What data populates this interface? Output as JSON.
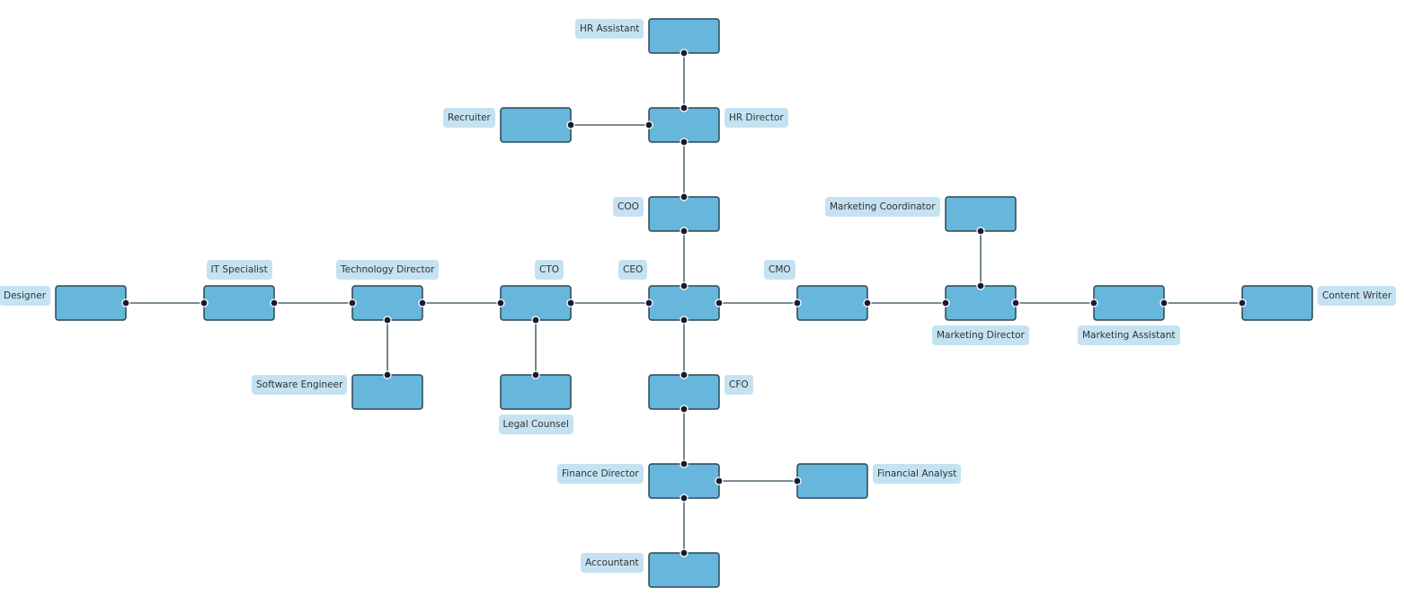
{
  "colors": {
    "node_fill": "#67b6db",
    "node_stroke": "#2b4756",
    "edge": "#2b4756",
    "port": "#1a1a2e",
    "label_bg": "#c4e2f2"
  },
  "nodes": [
    {
      "id": "hra",
      "label": "HR Assistant"
    },
    {
      "id": "hrd",
      "label": "HR Director"
    },
    {
      "id": "rec",
      "label": "Recruiter"
    },
    {
      "id": "coo",
      "label": "COO"
    },
    {
      "id": "mc",
      "label": "Marketing Coordinator"
    },
    {
      "id": "des",
      "label": "Designer"
    },
    {
      "id": "its",
      "label": "IT Specialist"
    },
    {
      "id": "td",
      "label": "Technology Director"
    },
    {
      "id": "cto",
      "label": "CTO"
    },
    {
      "id": "ceo",
      "label": "CEO"
    },
    {
      "id": "cmo",
      "label": "CMO"
    },
    {
      "id": "md",
      "label": "Marketing Director"
    },
    {
      "id": "ma",
      "label": "Marketing Assistant"
    },
    {
      "id": "cw",
      "label": "Content Writer"
    },
    {
      "id": "se",
      "label": "Software Engineer"
    },
    {
      "id": "lc",
      "label": "Legal Counsel"
    },
    {
      "id": "cfo",
      "label": "CFO"
    },
    {
      "id": "fd",
      "label": "Finance Director"
    },
    {
      "id": "fa",
      "label": "Financial Analyst"
    },
    {
      "id": "acc",
      "label": "Accountant"
    }
  ],
  "edges": [
    [
      "hra",
      "hrd"
    ],
    [
      "rec",
      "hrd"
    ],
    [
      "hrd",
      "coo"
    ],
    [
      "coo",
      "ceo"
    ],
    [
      "mc",
      "md"
    ],
    [
      "des",
      "its"
    ],
    [
      "its",
      "td"
    ],
    [
      "td",
      "cto"
    ],
    [
      "td",
      "se"
    ],
    [
      "cto",
      "ceo"
    ],
    [
      "cto",
      "lc"
    ],
    [
      "ceo",
      "cmo"
    ],
    [
      "cmo",
      "md"
    ],
    [
      "md",
      "ma"
    ],
    [
      "ma",
      "cw"
    ],
    [
      "ceo",
      "cfo"
    ],
    [
      "cfo",
      "fd"
    ],
    [
      "fd",
      "fa"
    ],
    [
      "fd",
      "acc"
    ]
  ]
}
